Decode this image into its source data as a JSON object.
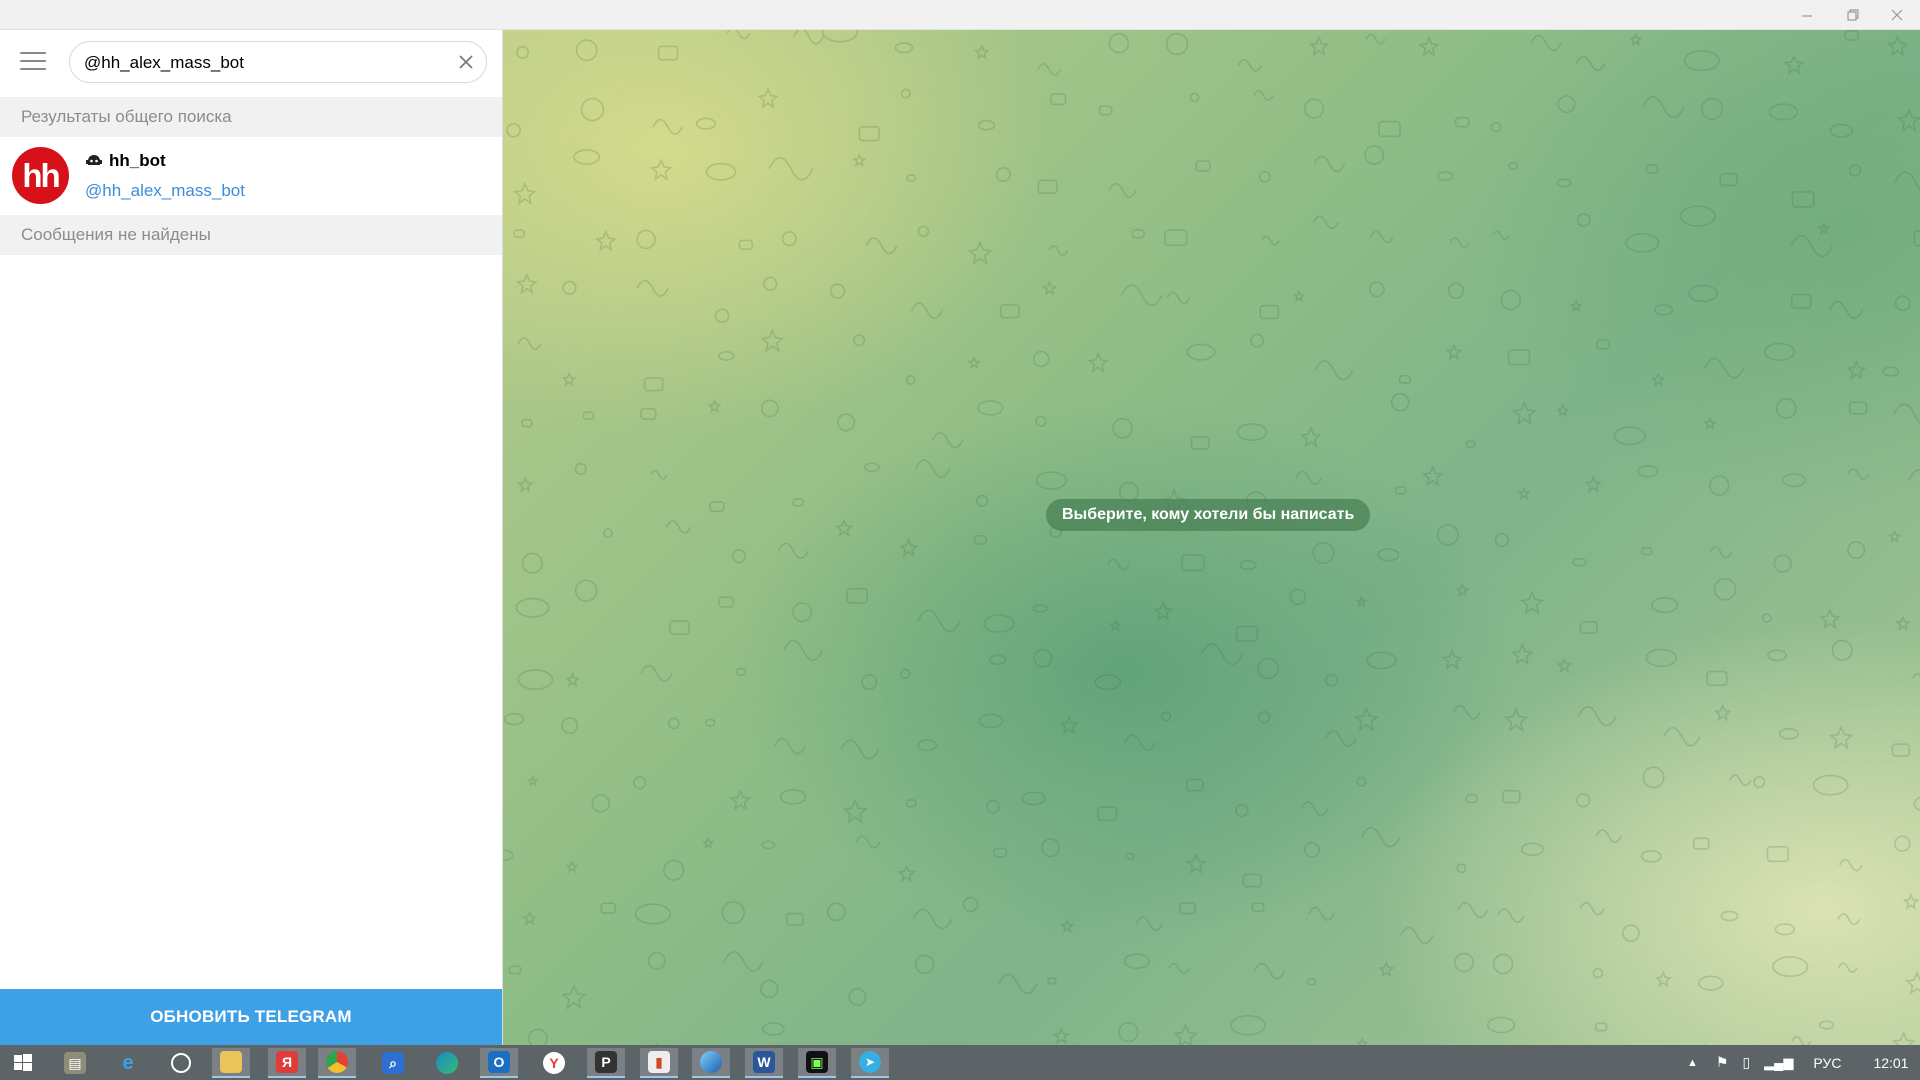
{
  "window": {
    "minimize_icon": "minimize-icon",
    "restore_icon": "restore-icon",
    "close_icon": "close-icon"
  },
  "sidebar": {
    "search_value": "@hh_alex_mass_bot",
    "global_results_header": "Результаты общего поиска",
    "result": {
      "name": "hh_bot",
      "username": "@hh_alex_mass_bot",
      "avatar_text": "hh",
      "avatar_color": "#d6111a"
    },
    "no_messages_header": "Сообщения не найдены",
    "update_button": "ОБНОВИТЬ TELEGRAM"
  },
  "chat": {
    "empty_hint": "Выберите, кому хотели бы написать"
  },
  "taskbar": {
    "apps": [
      "start-icon",
      "file-manager-icon",
      "internet-explorer-icon",
      "browser-icon",
      "file-explorer-icon",
      "yandex-browser-icon",
      "chrome-icon",
      "search-app-icon",
      "edge-icon",
      "outlook-icon",
      "yandex-icon",
      "p-app-icon",
      "presentation-icon",
      "browser-app-icon",
      "word-icon",
      "terminal-icon",
      "telegram-icon"
    ],
    "language": "РУС",
    "time": "12:01"
  },
  "colors": {
    "accent": "#3ea0e5",
    "username_link": "#3a8ddb"
  }
}
